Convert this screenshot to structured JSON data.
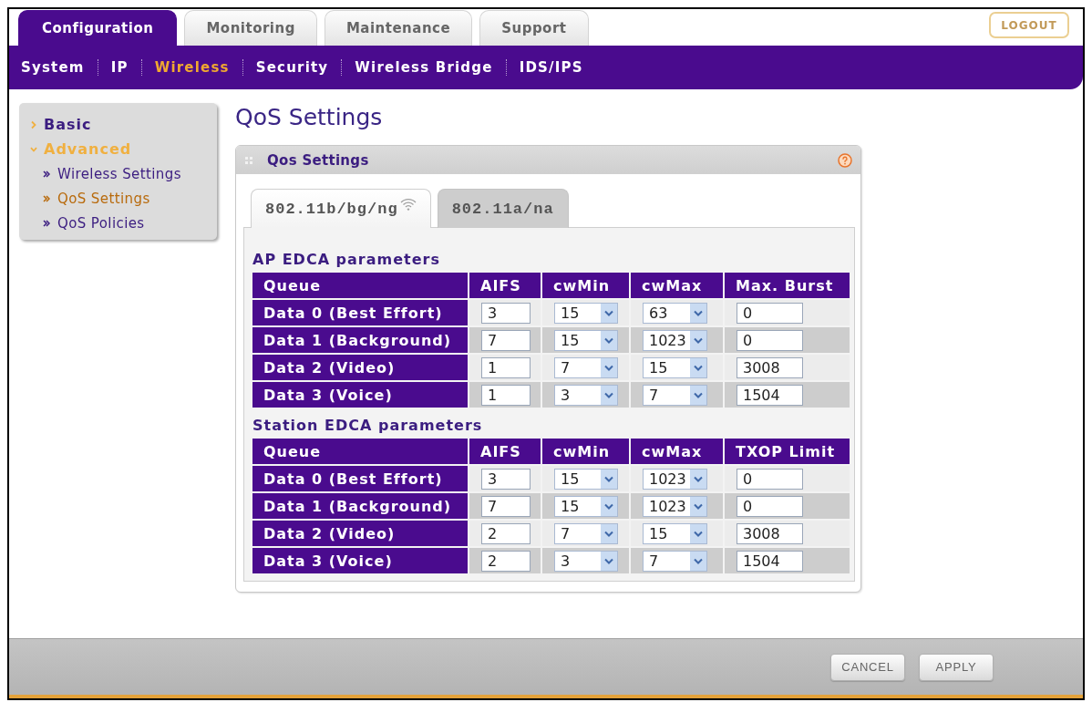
{
  "top_tabs": [
    {
      "label": "Configuration",
      "selected": true
    },
    {
      "label": "Monitoring",
      "selected": false
    },
    {
      "label": "Maintenance",
      "selected": false
    },
    {
      "label": "Support",
      "selected": false
    }
  ],
  "logout_button": "LOGOUT",
  "sub_nav": [
    {
      "label": "System",
      "selected": false
    },
    {
      "label": "IP",
      "selected": false
    },
    {
      "label": "Wireless",
      "selected": true
    },
    {
      "label": "Security",
      "selected": false
    },
    {
      "label": "Wireless Bridge",
      "selected": false
    },
    {
      "label": "IDS/IPS",
      "selected": false
    }
  ],
  "sidebar": {
    "items": [
      {
        "label": "Basic",
        "expanded": false,
        "selected": false
      },
      {
        "label": "Advanced",
        "expanded": true,
        "selected": true,
        "children": [
          {
            "label": "Wireless Settings",
            "selected": false
          },
          {
            "label": "QoS Settings",
            "selected": true
          },
          {
            "label": "QoS Policies",
            "selected": false
          }
        ]
      }
    ]
  },
  "page_title": "QoS Settings",
  "panel": {
    "title": "Qos Settings",
    "tabs": [
      {
        "label": "802.11b/bg/ng",
        "selected": true,
        "radio_on": true
      },
      {
        "label": "802.11a/na",
        "selected": false,
        "radio_on": false
      }
    ],
    "sections": [
      {
        "title": "AP EDCA parameters",
        "columns": [
          {
            "label": "Queue",
            "kind": "label"
          },
          {
            "label": "AIFS",
            "kind": "input"
          },
          {
            "label": "cwMin",
            "kind": "select"
          },
          {
            "label": "cwMax",
            "kind": "select"
          },
          {
            "label": "Max. Burst",
            "kind": "input"
          }
        ],
        "rows": [
          [
            "Data 0 (Best Effort)",
            "3",
            "15",
            "63",
            "0"
          ],
          [
            "Data 1 (Background)",
            "7",
            "15",
            "1023",
            "0"
          ],
          [
            "Data 2 (Video)",
            "1",
            "7",
            "15",
            "3008"
          ],
          [
            "Data 3 (Voice)",
            "1",
            "3",
            "7",
            "1504"
          ]
        ]
      },
      {
        "title": "Station EDCA parameters",
        "columns": [
          {
            "label": "Queue",
            "kind": "label"
          },
          {
            "label": "AIFS",
            "kind": "input"
          },
          {
            "label": "cwMin",
            "kind": "select"
          },
          {
            "label": "cwMax",
            "kind": "select"
          },
          {
            "label": "TXOP Limit",
            "kind": "input"
          }
        ],
        "rows": [
          [
            "Data 0 (Best Effort)",
            "3",
            "15",
            "1023",
            "0"
          ],
          [
            "Data 1 (Background)",
            "7",
            "15",
            "1023",
            "0"
          ],
          [
            "Data 2 (Video)",
            "2",
            "7",
            "15",
            "3008"
          ],
          [
            "Data 3 (Voice)",
            "2",
            "3",
            "7",
            "1504"
          ]
        ]
      }
    ]
  },
  "buttons": [
    "CANCEL",
    "APPLY"
  ]
}
